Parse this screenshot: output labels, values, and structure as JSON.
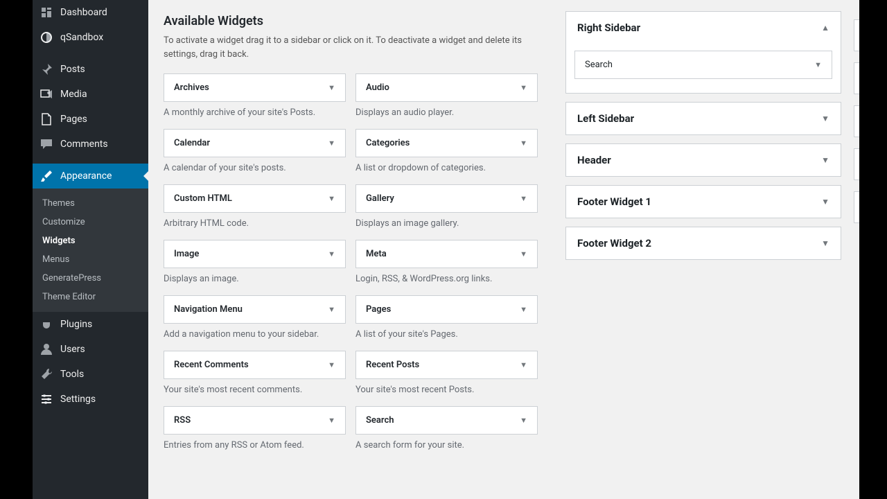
{
  "sidebar": {
    "items": [
      {
        "label": "Dashboard",
        "icon": "dashboard"
      },
      {
        "label": "qSandbox",
        "icon": "sandbox"
      },
      {
        "label": "Posts",
        "icon": "posts"
      },
      {
        "label": "Media",
        "icon": "media"
      },
      {
        "label": "Pages",
        "icon": "pages"
      },
      {
        "label": "Comments",
        "icon": "comments"
      },
      {
        "label": "Appearance",
        "icon": "appearance",
        "active": true
      },
      {
        "label": "Plugins",
        "icon": "plugins"
      },
      {
        "label": "Users",
        "icon": "users"
      },
      {
        "label": "Tools",
        "icon": "tools"
      },
      {
        "label": "Settings",
        "icon": "settings"
      }
    ],
    "submenu": [
      {
        "label": "Themes"
      },
      {
        "label": "Customize"
      },
      {
        "label": "Widgets",
        "current": true
      },
      {
        "label": "Menus"
      },
      {
        "label": "GeneratePress"
      },
      {
        "label": "Theme Editor"
      }
    ]
  },
  "available_widgets": {
    "title": "Available Widgets",
    "description": "To activate a widget drag it to a sidebar or click on it. To deactivate a widget and delete its settings, drag it back.",
    "widgets": [
      {
        "name": "Archives",
        "desc": "A monthly archive of your site's Posts."
      },
      {
        "name": "Audio",
        "desc": "Displays an audio player."
      },
      {
        "name": "Calendar",
        "desc": "A calendar of your site's posts."
      },
      {
        "name": "Categories",
        "desc": "A list or dropdown of categories."
      },
      {
        "name": "Custom HTML",
        "desc": "Arbitrary HTML code."
      },
      {
        "name": "Gallery",
        "desc": "Displays an image gallery."
      },
      {
        "name": "Image",
        "desc": "Displays an image."
      },
      {
        "name": "Meta",
        "desc": "Login, RSS, & WordPress.org links."
      },
      {
        "name": "Navigation Menu",
        "desc": "Add a navigation menu to your sidebar."
      },
      {
        "name": "Pages",
        "desc": "A list of your site's Pages."
      },
      {
        "name": "Recent Comments",
        "desc": "Your site's most recent comments."
      },
      {
        "name": "Recent Posts",
        "desc": "Your site's most recent Posts."
      },
      {
        "name": "RSS",
        "desc": "Entries from any RSS or Atom feed."
      },
      {
        "name": "Search",
        "desc": "A search form for your site."
      }
    ]
  },
  "sidebar_areas": [
    {
      "name": "Right Sidebar",
      "expanded": true,
      "widgets": [
        {
          "name": "Search"
        }
      ]
    },
    {
      "name": "Left Sidebar",
      "expanded": false
    },
    {
      "name": "Header",
      "expanded": false
    },
    {
      "name": "Footer Widget 1",
      "expanded": false
    },
    {
      "name": "Footer Widget 2",
      "expanded": false
    }
  ]
}
